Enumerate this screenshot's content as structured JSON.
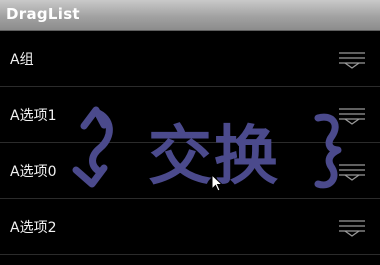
{
  "app": {
    "title": "DragList"
  },
  "list": {
    "items": [
      {
        "label": "A组",
        "kind": "group"
      },
      {
        "label": "A选项1",
        "kind": "item"
      },
      {
        "label": "A选项0",
        "kind": "item"
      },
      {
        "label": "A选项2",
        "kind": "item"
      }
    ]
  },
  "annotation": {
    "text": "交换",
    "color": "#4b4a8c"
  },
  "icons": {
    "drag_handle": "drag-handle-icon",
    "cursor": "mouse-pointer-icon"
  }
}
